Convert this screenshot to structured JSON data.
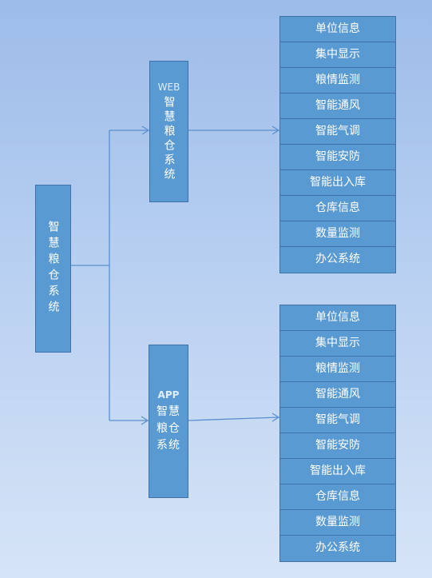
{
  "root": {
    "label": "智慧粮仓系统"
  },
  "web": {
    "prefix": "WEB",
    "label": "智慧粮仓系统"
  },
  "app": {
    "prefix": "APP",
    "label": "智慧粮仓系统"
  },
  "web_modules": [
    "单位信息",
    "集中显示",
    "粮情监测",
    "智能通风",
    "智能气调",
    "智能安防",
    "智能出入库",
    "仓库信息",
    "数量监测",
    "办公系统"
  ],
  "app_modules": [
    "单位信息",
    "集中显示",
    "粮情监测",
    "智能通风",
    "智能气调",
    "智能安防",
    "智能出入库",
    "仓库信息",
    "数量监测",
    "办公系统"
  ],
  "colors": {
    "box": "#5a9ad3",
    "border": "#3f72a8",
    "connector": "#5b8fd0"
  }
}
